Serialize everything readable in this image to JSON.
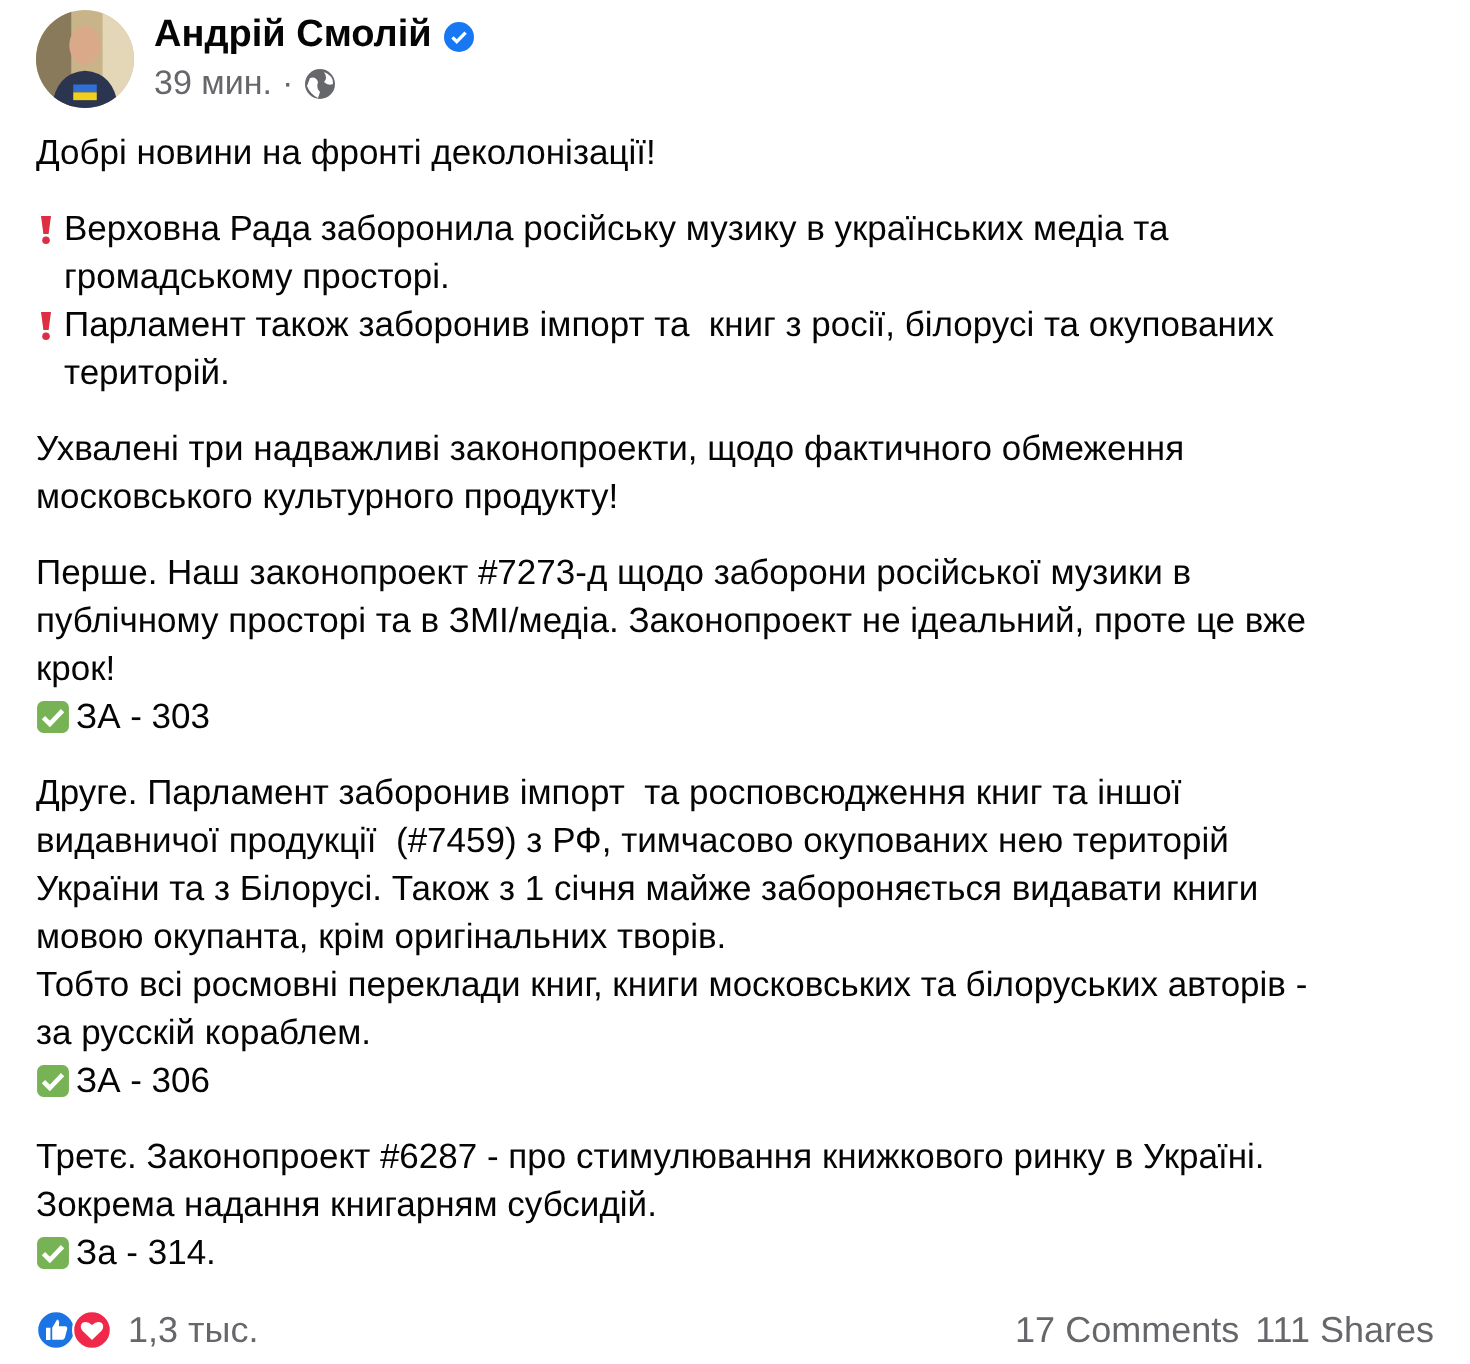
{
  "post": {
    "author": "Андрій Смолій",
    "verified": true,
    "time": "39 мин.",
    "separator": "·"
  },
  "paragraphs": [
    {
      "lines": [
        {
          "kind": "plain",
          "text": "Добрі новини на фронті деколонізації!"
        }
      ]
    },
    {
      "lines": [
        {
          "kind": "warning",
          "text": "Верховна Рада заборонила російську музику в українських медіа та\nгромадському просторі."
        },
        {
          "kind": "warning",
          "text": "Парламент також заборонив імпорт та  книг з росії, білорусі та окупованих\nтериторій."
        }
      ]
    },
    {
      "lines": [
        {
          "kind": "plain",
          "text": "Ухвалені три надважливі законопроекти, щодо фактичного обмеження\nмосковського культурного продукту!"
        }
      ]
    },
    {
      "lines": [
        {
          "kind": "plain",
          "text": "Перше. Наш законопроект #7273-д щодо заборони російської музики в\nпублічному просторі та в ЗМІ/медіа. Законопроект не ідеальний, проте це вже\nкрок!"
        },
        {
          "kind": "vote",
          "text": "ЗА - 303"
        }
      ]
    },
    {
      "lines": [
        {
          "kind": "plain",
          "text": "Друге. Парламент заборонив імпорт  та росповсюдження книг та іншої\nвидавничої продукції  (#7459) з РФ, тимчасово окупованих нею територій\nУкраїни та з Білорусі. Також з 1 січня майже забороняється видавати книги\nмовою окупанта, крім оригінальних творів.\nТобто всі росмовні переклади книг, книги московських та білоруських авторів -\nза русскій кораблем."
        },
        {
          "kind": "vote",
          "text": "ЗА - 306"
        }
      ]
    },
    {
      "lines": [
        {
          "kind": "plain",
          "text": "Третє. Законопроект #6287 - про стимулювання книжкового ринку в Україні.\nЗокрема надання книгарням субсидій."
        },
        {
          "kind": "vote",
          "text": "За - 314."
        }
      ]
    }
  ],
  "footer": {
    "reaction_count": "1,3 тыс.",
    "comments": "17 Comments",
    "shares": "111 Shares"
  }
}
